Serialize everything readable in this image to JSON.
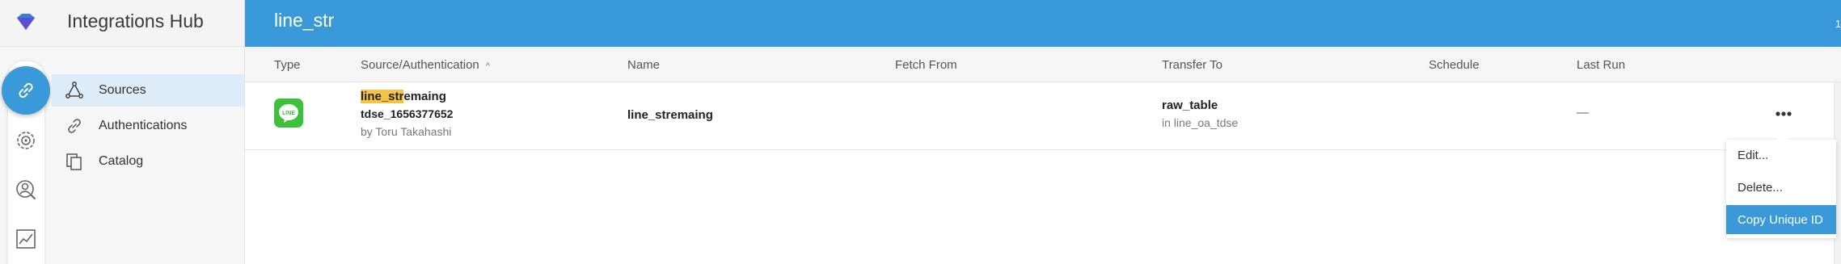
{
  "app": {
    "title": "Integrations Hub",
    "logo_icon": "diamond-logo-icon",
    "accent": "#3a9ad9"
  },
  "header": {
    "page_title": "line_str",
    "trailing_text": "1"
  },
  "rail": [
    {
      "name": "integrations",
      "icon": "link-icon",
      "active": true
    },
    {
      "name": "settings",
      "icon": "gear-icon",
      "active": false
    },
    {
      "name": "profiles",
      "icon": "user-search-icon",
      "active": false
    },
    {
      "name": "analytics",
      "icon": "chart-icon",
      "active": false
    }
  ],
  "nav": {
    "items": [
      {
        "label": "Sources",
        "icon": "nodes-icon",
        "active": true
      },
      {
        "label": "Authentications",
        "icon": "link-icon",
        "active": false
      },
      {
        "label": "Catalog",
        "icon": "documents-icon",
        "active": false
      }
    ]
  },
  "table": {
    "columns": {
      "type": "Type",
      "source": "Source/Authentication",
      "sort_indicator": "^",
      "name": "Name",
      "fetch_from": "Fetch From",
      "transfer_to": "Transfer To",
      "schedule": "Schedule",
      "last_run": "Last Run"
    },
    "rows": [
      {
        "type_icon": "line-logo-icon",
        "type_logo_text": "LINE",
        "source_highlight": "line_str",
        "source_rest": "emaing",
        "auth": "tdse_1656377652",
        "owner": "by Toru Takahashi",
        "name": "line_stremaing",
        "fetch_from": "",
        "transfer_to": "raw_table",
        "transfer_db": "in line_oa_tdse",
        "schedule": "",
        "last_run": "—"
      }
    ]
  },
  "row_menu": {
    "items": [
      "Edit...",
      "Delete...",
      "Copy Unique ID"
    ],
    "selected": "Copy Unique ID"
  }
}
